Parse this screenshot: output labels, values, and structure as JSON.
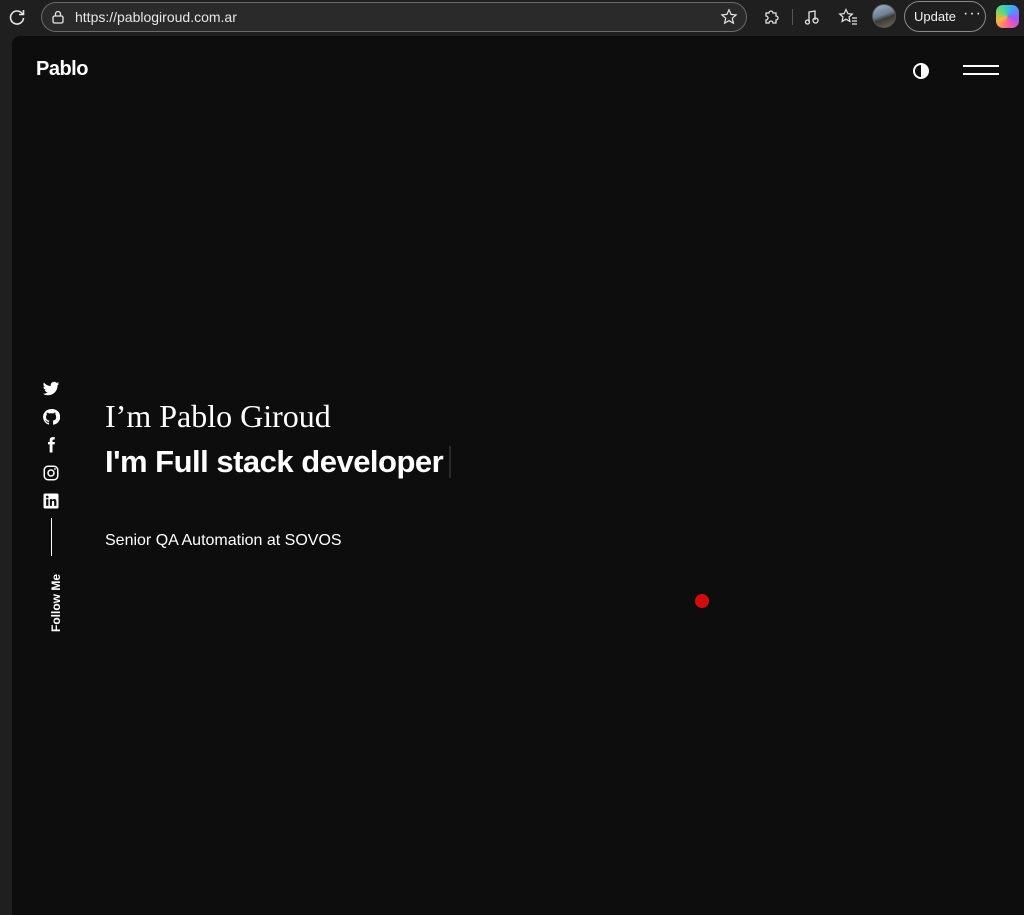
{
  "browser": {
    "url": "https://pablogiroud.com.ar",
    "update_label": "Update",
    "more_label": "···",
    "icons": [
      "reload-icon",
      "lock-icon",
      "favorite-star-icon",
      "extensions-icon",
      "media-icon",
      "favorites-icon",
      "profile-avatar",
      "copilot-icon"
    ]
  },
  "site": {
    "brand": "Pablo",
    "hero_name": "I’m Pablo Giroud",
    "hero_role": "I'm Full stack developer",
    "subtitle": "Senior QA Automation at SOVOS",
    "follow_label": "Follow Me",
    "social": [
      "twitter-icon",
      "github-icon",
      "facebook-icon",
      "instagram-icon",
      "linkedin-icon"
    ]
  },
  "colors": {
    "page_bg": "#0d0d0e",
    "chrome_bg": "#1f1f1f",
    "text": "#ffffff",
    "cursor_dot": "#d10c0c"
  }
}
